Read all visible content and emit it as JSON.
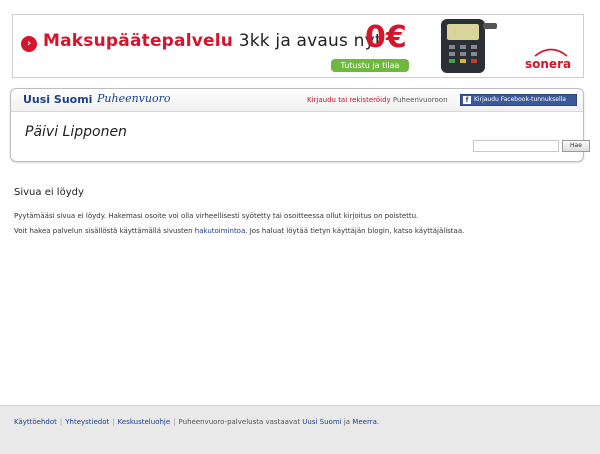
{
  "ad": {
    "text_red": "Maksupäätepalvelu",
    "text_dark": " 3kk ja avaus nyt",
    "price": "0€",
    "cta_label": "Tutustu ja tilaa",
    "brand": "sonera"
  },
  "header": {
    "logo_uusi_suomi": "Uusi Suomi",
    "logo_puheenvuoro": "Puheenvuoro",
    "login_link": "Kirjaudu tai rekisteröidy",
    "login_suffix": " Puheenvuoroon",
    "facebook_button": "Kirjaudu Facebook-tunnuksella",
    "page_title": "Päivi Lipponen",
    "search_placeholder": "",
    "search_button": "Hae"
  },
  "main": {
    "title": "Sivua ei löydy",
    "message_1": "Pyytämääsi sivua ei löydy. Hakemasi osoite voi olla virheellisesti syötetty tai osoitteessa ollut kirjoitus on poistettu.",
    "message_2_prefix": "Voit hakea palvelun sisällöstä käyttämällä sivusten ",
    "message_2_link": "hakutoimintoa",
    "message_2_suffix": ". Jos haluat löytää tietyn käyttäjän blogin, katso käyttäjälistaa."
  },
  "footer": {
    "link_terms": "Käyttöehdot",
    "link_contact": "Yhteystiedot",
    "link_rules": "Keskusteluohje",
    "text_prefix": "Puheenvuoro-palvelusta vastaavat ",
    "link_publisher": "Uusi Suomi",
    "text_and": " ja ",
    "link_partner": "Meerra",
    "text_end": "."
  },
  "colors": {
    "brand_red": "#d6142b",
    "link_blue": "#1d3f8c",
    "facebook_blue": "#3b5998",
    "cta_green": "#6fb83e"
  }
}
